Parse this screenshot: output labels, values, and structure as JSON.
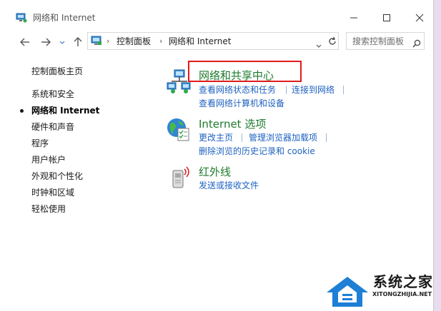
{
  "window": {
    "title": "网络和 Internet"
  },
  "address": {
    "crumbs": [
      "控制面板",
      "网络和 Internet"
    ]
  },
  "search": {
    "placeholder": "搜索控制面板"
  },
  "sidebar": {
    "items": [
      {
        "label": "控制面板主页"
      },
      {
        "label": "系统和安全"
      },
      {
        "label": "网络和 Internet",
        "active": true
      },
      {
        "label": "硬件和声音"
      },
      {
        "label": "程序"
      },
      {
        "label": "用户帐户"
      },
      {
        "label": "外观和个性化"
      },
      {
        "label": "时钟和区域"
      },
      {
        "label": "轻松使用"
      }
    ]
  },
  "categories": [
    {
      "title": "网络和共享中心",
      "icon": "network-sharing-icon",
      "links": [
        "查看网络状态和任务",
        "连接到网络",
        "查看网络计算机和设备"
      ]
    },
    {
      "title": "Internet 选项",
      "icon": "internet-options-icon",
      "links": [
        "更改主页",
        "管理浏览器加载项",
        "删除浏览的历史记录和 cookie"
      ]
    },
    {
      "title": "红外线",
      "icon": "infrared-icon",
      "links": [
        "发送或接收文件"
      ]
    }
  ],
  "watermark": {
    "title": "系统之家",
    "subtitle": "XITONGZHIJIA.NET"
  },
  "colors": {
    "category_title": "#1e7a2c",
    "link": "#1e62c1",
    "highlight": "#e01a1a"
  }
}
